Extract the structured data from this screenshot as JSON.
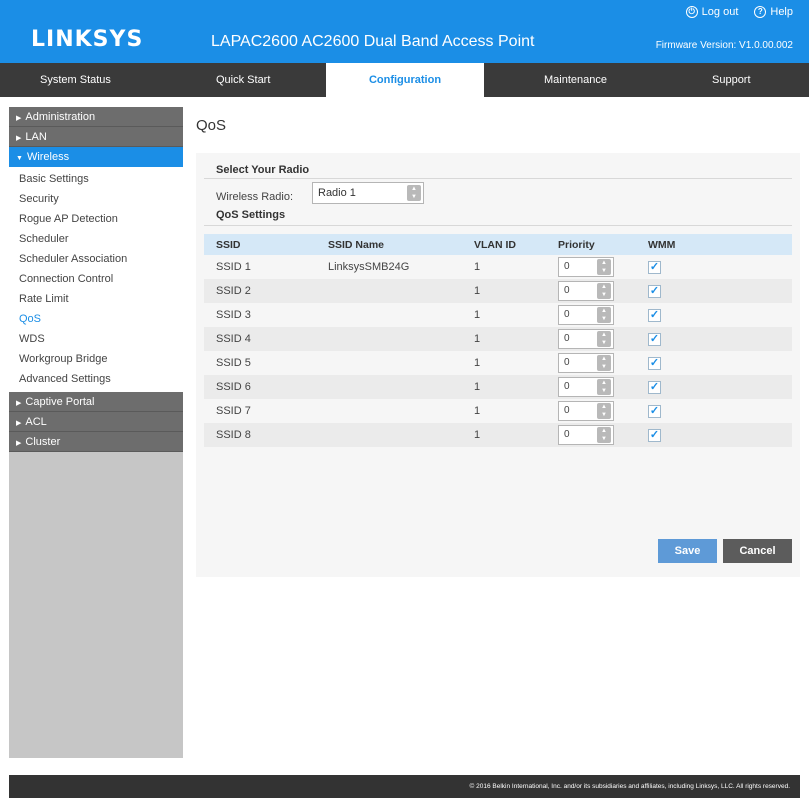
{
  "header": {
    "brand": "LINKSYS",
    "product": "LAPAC2600 AC2600 Dual Band Access Point",
    "logout_label": "Log out",
    "help_label": "Help",
    "firmware": "Firmware Version: V1.0.00.002",
    "brand_color": "#1b8ee6"
  },
  "nav": {
    "tabs": [
      {
        "label": "System Status"
      },
      {
        "label": "Quick Start"
      },
      {
        "label": "Configuration"
      },
      {
        "label": "Maintenance"
      },
      {
        "label": "Support"
      }
    ],
    "active": "Configuration"
  },
  "sidebar": {
    "administration": "Administration",
    "lan": "LAN",
    "wireless": "Wireless",
    "wireless_items": [
      {
        "label": "Basic Settings"
      },
      {
        "label": "Security"
      },
      {
        "label": "Rogue AP Detection"
      },
      {
        "label": "Scheduler"
      },
      {
        "label": "Scheduler Association"
      },
      {
        "label": "Connection Control"
      },
      {
        "label": "Rate Limit"
      },
      {
        "label": "QoS"
      },
      {
        "label": "WDS"
      },
      {
        "label": "Workgroup Bridge"
      },
      {
        "label": "Advanced Settings"
      }
    ],
    "captive_portal": "Captive Portal",
    "acl": "ACL",
    "cluster": "Cluster"
  },
  "page": {
    "title": "QoS",
    "select_radio_heading": "Select Your Radio",
    "wireless_radio_label": "Wireless Radio:",
    "wireless_radio_value": "Radio 1",
    "qos_settings_heading": "QoS Settings",
    "table": {
      "headers": [
        "SSID",
        "SSID Name",
        "VLAN ID",
        "Priority",
        "WMM"
      ],
      "rows": [
        {
          "ssid": "SSID 1",
          "name": "LinksysSMB24G",
          "vlan": "1",
          "priority": "0",
          "wmm": "✓"
        },
        {
          "ssid": "SSID 2",
          "name": "",
          "vlan": "1",
          "priority": "0",
          "wmm": "✓"
        },
        {
          "ssid": "SSID 3",
          "name": "",
          "vlan": "1",
          "priority": "0",
          "wmm": "✓"
        },
        {
          "ssid": "SSID 4",
          "name": "",
          "vlan": "1",
          "priority": "0",
          "wmm": "✓"
        },
        {
          "ssid": "SSID 5",
          "name": "",
          "vlan": "1",
          "priority": "0",
          "wmm": "✓"
        },
        {
          "ssid": "SSID 6",
          "name": "",
          "vlan": "1",
          "priority": "0",
          "wmm": "✓"
        },
        {
          "ssid": "SSID 7",
          "name": "",
          "vlan": "1",
          "priority": "0",
          "wmm": "✓"
        },
        {
          "ssid": "SSID 8",
          "name": "",
          "vlan": "1",
          "priority": "0",
          "wmm": "✓"
        }
      ]
    },
    "save_label": "Save",
    "cancel_label": "Cancel"
  },
  "footer": {
    "copyright": "© 2016 Belkin International, Inc. and/or its subsidiaries and affiliates, including Linksys, LLC. All rights reserved."
  }
}
